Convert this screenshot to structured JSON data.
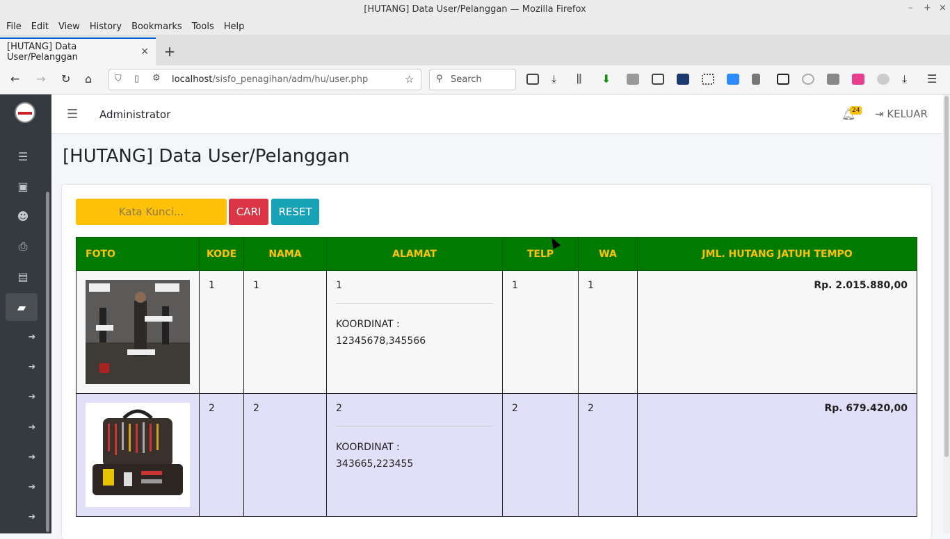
{
  "window": {
    "title": "[HUTANG] Data User/Pelanggan — Mozilla Firefox"
  },
  "menu": [
    "File",
    "Edit",
    "View",
    "History",
    "Bookmarks",
    "Tools",
    "Help"
  ],
  "tab": {
    "label": "[HUTANG] Data User/Pelanggan"
  },
  "url": {
    "host": "localhost",
    "path": "/sisfo_penagihan/adm/hu/user.php"
  },
  "search": {
    "placeholder": "Search"
  },
  "topnav": {
    "user": "Administrator",
    "notif_count": "24",
    "logout": "KELUAR"
  },
  "page": {
    "title": "[HUTANG] Data User/Pelanggan"
  },
  "filter": {
    "placeholder": "Kata Kunci...",
    "cari": "CARI",
    "reset": "RESET"
  },
  "table": {
    "headers": [
      "FOTO",
      "KODE",
      "NAMA",
      "ALAMAT",
      "TELP",
      "WA",
      "JML. HUTANG JATUH TEMPO"
    ],
    "rows": [
      {
        "kode": "1",
        "nama": "1",
        "alamat": "1",
        "koordinat_label": "KOORDINAT :",
        "koordinat": "12345678,345566",
        "telp": "1",
        "wa": "1",
        "hutang": "Rp. 2.015.880,00"
      },
      {
        "kode": "2",
        "nama": "2",
        "alamat": "2",
        "koordinat_label": "KOORDINAT :",
        "koordinat": "343665,223455",
        "telp": "2",
        "wa": "2",
        "hutang": "Rp. 679.420,00"
      }
    ]
  },
  "colors": {
    "header_bg": "#007b00",
    "header_text": "#ffc107",
    "row1": "#f7f7f7",
    "row2": "#e2e0f8",
    "sidebar": "#343a40"
  }
}
